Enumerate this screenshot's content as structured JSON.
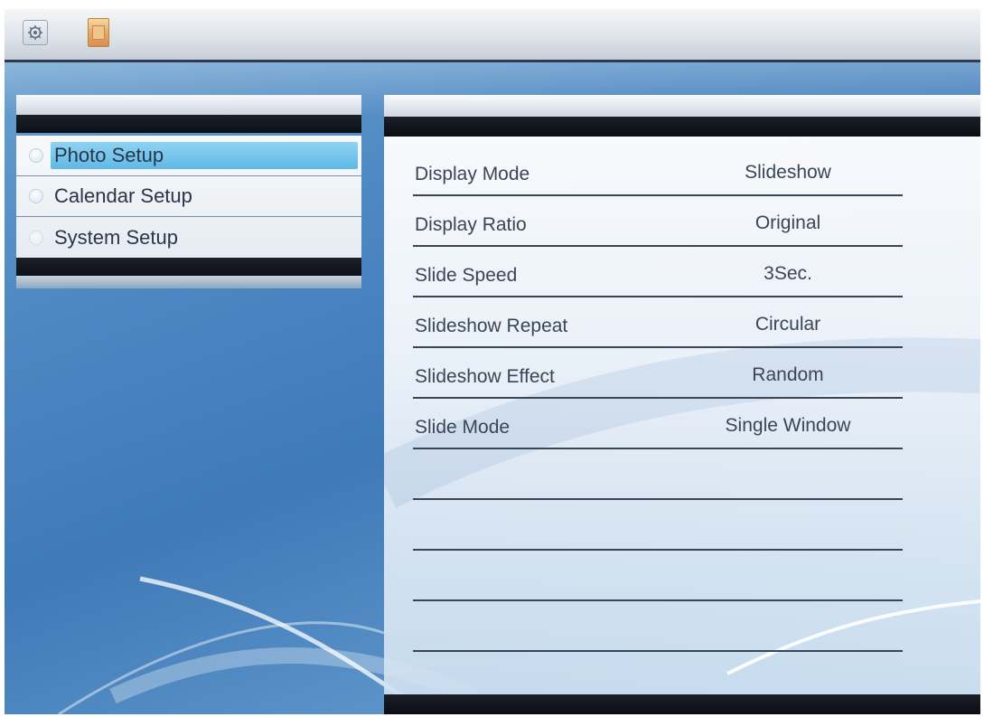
{
  "menu": {
    "items": [
      {
        "label": "Photo Setup",
        "selected": true
      },
      {
        "label": "Calendar Setup",
        "selected": false
      },
      {
        "label": "System Setup",
        "selected": false
      }
    ]
  },
  "settings": {
    "rows": [
      {
        "name": "Display Mode",
        "value": "Slideshow"
      },
      {
        "name": "Display Ratio",
        "value": "Original"
      },
      {
        "name": "Slide Speed",
        "value": "3Sec."
      },
      {
        "name": "Slideshow Repeat",
        "value": "Circular"
      },
      {
        "name": "Slideshow Effect",
        "value": "Random"
      },
      {
        "name": "Slide Mode",
        "value": "Single Window"
      },
      {
        "name": "",
        "value": ""
      },
      {
        "name": "",
        "value": ""
      },
      {
        "name": "",
        "value": ""
      },
      {
        "name": "",
        "value": ""
      }
    ]
  },
  "icons": {
    "titlebar_left": "settings-icon",
    "titlebar_right": "photo-icon"
  },
  "colors": {
    "background": "#4d88c3",
    "highlight": "#5fb8e6",
    "text": "#2a3548"
  }
}
